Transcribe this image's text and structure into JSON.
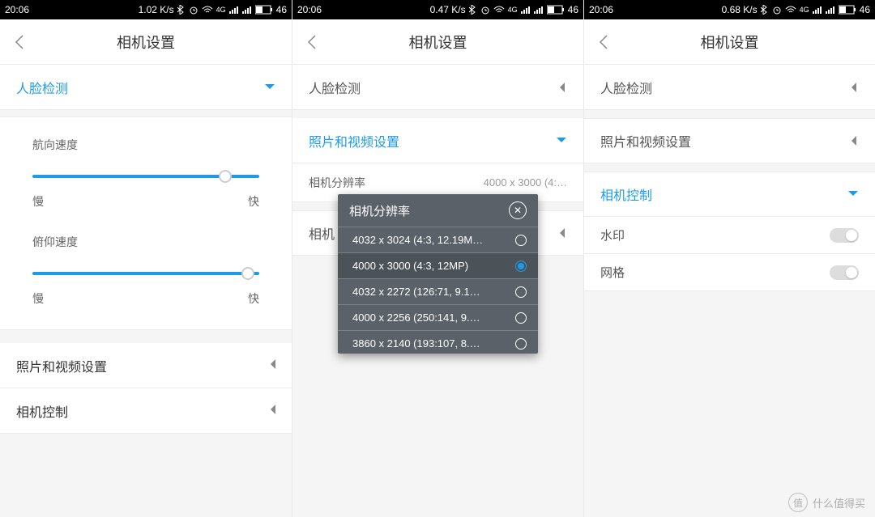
{
  "status": {
    "time": "20:06",
    "speed": [
      "1.02 K/s",
      "0.47 K/s",
      "0.68 K/s"
    ],
    "battery": "46"
  },
  "header": {
    "title": "相机设置"
  },
  "accent": "#1e9be8",
  "pane1": {
    "section_open": "人脸检测",
    "slider1": {
      "title": "航向速度",
      "slow": "慢",
      "fast": "快",
      "pct": 85
    },
    "slider2": {
      "title": "俯仰速度",
      "slow": "慢",
      "fast": "快",
      "pct": 95
    },
    "sections_collapsed": [
      "照片和视频设置",
      "相机控制"
    ]
  },
  "pane2": {
    "sections": [
      {
        "label": "人脸检测",
        "open": false
      },
      {
        "label": "照片和视频设置",
        "open": true
      }
    ],
    "subrow": {
      "label": "相机分辨率",
      "value": "4000 x 3000 (4:…"
    },
    "subrow2": {
      "label": "相机",
      "open": false
    },
    "dialog": {
      "title": "相机分辨率",
      "options": [
        "4032 x 3024 (4:3, 12.19M…",
        "4000 x 3000 (4:3, 12MP)",
        "4032 x 2272 (126:71, 9.1…",
        "4000 x 2256 (250:141, 9.…",
        "3860 x 2140 (193:107, 8.…"
      ],
      "selected": 1
    }
  },
  "pane3": {
    "sections": [
      {
        "label": "人脸检测",
        "open": false
      },
      {
        "label": "照片和视频设置",
        "open": false
      },
      {
        "label": "相机控制",
        "open": true
      }
    ],
    "toggles": [
      {
        "label": "水印",
        "on": false
      },
      {
        "label": "网格",
        "on": false
      }
    ]
  },
  "watermark": {
    "badge": "值",
    "text": "什么值得买"
  }
}
